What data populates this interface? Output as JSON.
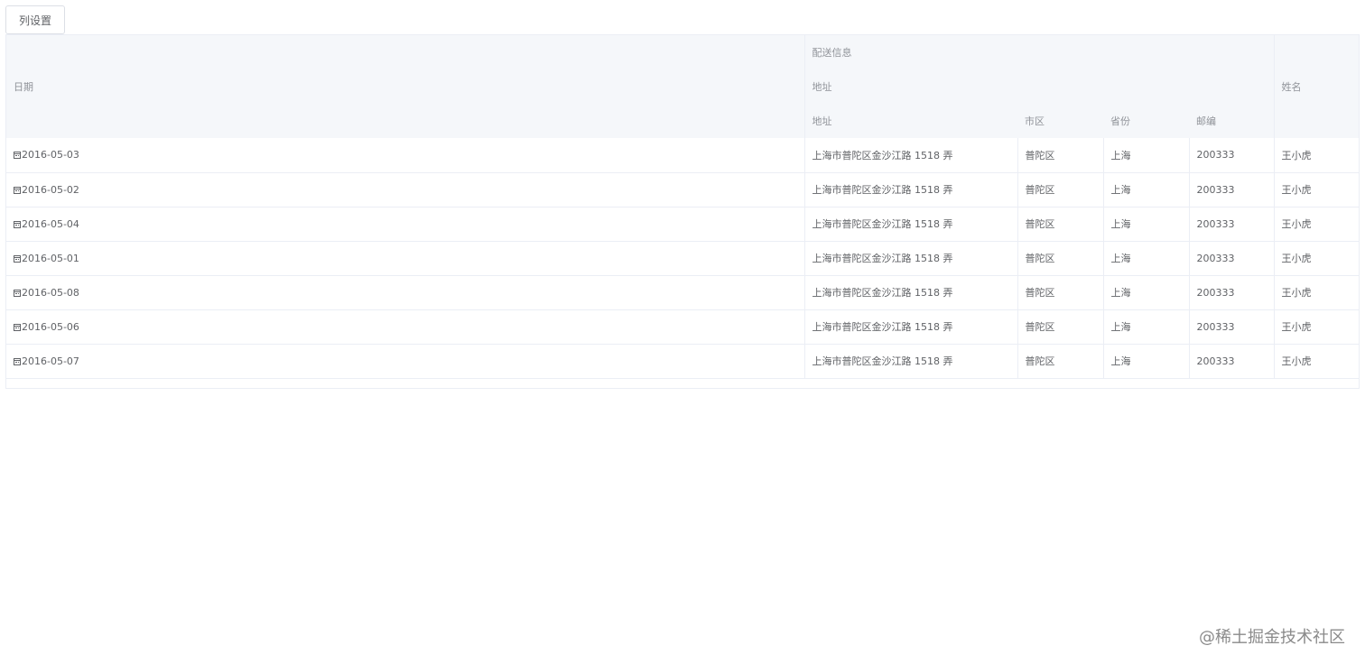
{
  "toolbar": {
    "column_settings_label": "列设置"
  },
  "table": {
    "headers": {
      "date": "日期",
      "delivery_group": "配送信息",
      "address_group": "地址",
      "address": "地址",
      "city": "市区",
      "province": "省份",
      "zip": "邮编",
      "name": "姓名"
    },
    "rows": [
      {
        "date": "2016-05-03",
        "address": "上海市普陀区金沙江路 1518 弄",
        "city": "普陀区",
        "province": "上海",
        "zip": "200333",
        "name": "王小虎"
      },
      {
        "date": "2016-05-02",
        "address": "上海市普陀区金沙江路 1518 弄",
        "city": "普陀区",
        "province": "上海",
        "zip": "200333",
        "name": "王小虎"
      },
      {
        "date": "2016-05-04",
        "address": "上海市普陀区金沙江路 1518 弄",
        "city": "普陀区",
        "province": "上海",
        "zip": "200333",
        "name": "王小虎"
      },
      {
        "date": "2016-05-01",
        "address": "上海市普陀区金沙江路 1518 弄",
        "city": "普陀区",
        "province": "上海",
        "zip": "200333",
        "name": "王小虎"
      },
      {
        "date": "2016-05-08",
        "address": "上海市普陀区金沙江路 1518 弄",
        "city": "普陀区",
        "province": "上海",
        "zip": "200333",
        "name": "王小虎"
      },
      {
        "date": "2016-05-06",
        "address": "上海市普陀区金沙江路 1518 弄",
        "city": "普陀区",
        "province": "上海",
        "zip": "200333",
        "name": "王小虎"
      },
      {
        "date": "2016-05-07",
        "address": "上海市普陀区金沙江路 1518 弄",
        "city": "普陀区",
        "province": "上海",
        "zip": "200333",
        "name": "王小虎"
      }
    ]
  },
  "watermark": "@稀土掘金技术社区",
  "icons": {
    "date_cell_icon": "calendar-icon"
  }
}
